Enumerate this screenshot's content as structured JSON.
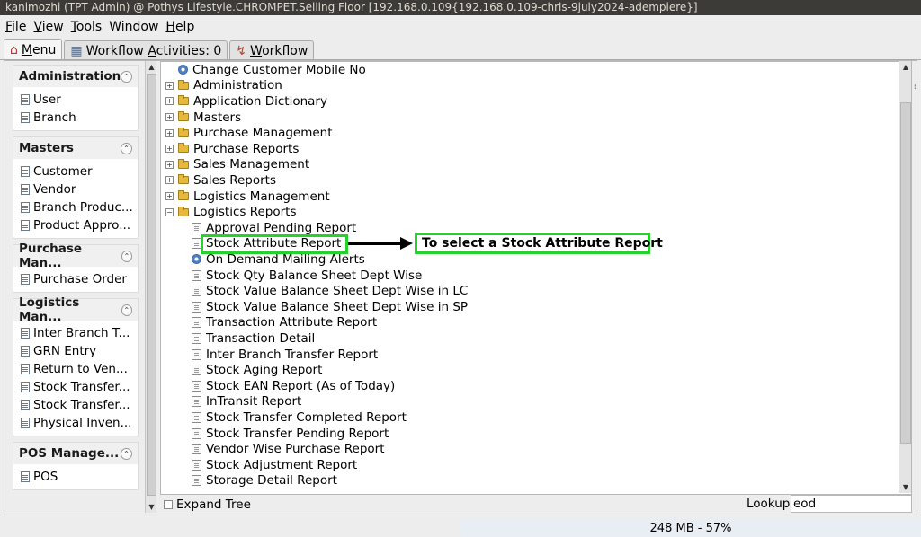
{
  "window": {
    "title": "kanimozhi (TPT Admin) @ Pothys Lifestyle.CHROMPET.Selling Floor [192.168.0.109{192.168.0.109-chrls-9july2024-adempiere}]"
  },
  "menu": [
    {
      "label": "File",
      "mnemonic": "F",
      "rest": "ile"
    },
    {
      "label": "View",
      "mnemonic": "V",
      "rest": "iew"
    },
    {
      "label": "Tools",
      "mnemonic": "T",
      "rest": "ools"
    },
    {
      "label": "Window",
      "mnemonic": "",
      "rest": "Window"
    },
    {
      "label": "Help",
      "mnemonic": "H",
      "rest": "elp"
    }
  ],
  "tabs": [
    {
      "label_pre": "",
      "label_mn": "M",
      "label_post": "enu",
      "icon": "home-icon"
    },
    {
      "label_pre": "Workflow ",
      "label_mn": "A",
      "label_post": "ctivities: 0",
      "icon": "calendar-icon"
    },
    {
      "label_pre": "",
      "label_mn": "W",
      "label_post": "orkflow",
      "icon": "workflow-icon"
    }
  ],
  "sidebar": {
    "groups": [
      {
        "title": "Administration",
        "items": [
          "User",
          "Branch"
        ]
      },
      {
        "title": "Masters",
        "items": [
          "Customer",
          "Vendor",
          "Branch Produc...",
          "Product Appro..."
        ]
      },
      {
        "title": "Purchase Man...",
        "items": [
          "Purchase Order"
        ]
      },
      {
        "title": "Logistics Man...",
        "items": [
          "Inter Branch T...",
          "GRN Entry",
          "Return to Ven...",
          "Stock Transfer...",
          "Stock Transfer...",
          "Physical Inven..."
        ]
      },
      {
        "title": "POS Manage...",
        "items": [
          "POS"
        ]
      }
    ]
  },
  "tree": {
    "items": [
      {
        "label": "Change Customer Mobile No",
        "kind": "process",
        "level": 1
      },
      {
        "label": "Administration",
        "kind": "folder",
        "level": 0,
        "expanded": false
      },
      {
        "label": "Application Dictionary",
        "kind": "folder",
        "level": 0,
        "expanded": false
      },
      {
        "label": "Masters",
        "kind": "folder",
        "level": 0,
        "expanded": false
      },
      {
        "label": "Purchase Management",
        "kind": "folder",
        "level": 0,
        "expanded": false
      },
      {
        "label": "Purchase Reports",
        "kind": "folder",
        "level": 0,
        "expanded": false
      },
      {
        "label": "Sales Management",
        "kind": "folder",
        "level": 0,
        "expanded": false
      },
      {
        "label": "Sales Reports",
        "kind": "folder",
        "level": 0,
        "expanded": false
      },
      {
        "label": "Logistics Management",
        "kind": "folder",
        "level": 0,
        "expanded": false
      },
      {
        "label": "Logistics Reports",
        "kind": "folder",
        "level": 0,
        "expanded": true
      },
      {
        "label": "Approval Pending Report",
        "kind": "report",
        "level": 2
      },
      {
        "label": "Stock Attribute Report",
        "kind": "report",
        "level": 2
      },
      {
        "label": "On Demand Mailing Alerts",
        "kind": "process",
        "level": 2
      },
      {
        "label": "Stock Qty Balance Sheet Dept Wise",
        "kind": "report",
        "level": 2
      },
      {
        "label": "Stock Value Balance Sheet Dept Wise in LC",
        "kind": "report",
        "level": 2
      },
      {
        "label": "Stock Value Balance Sheet Dept Wise in SP",
        "kind": "report",
        "level": 2
      },
      {
        "label": "Transaction Attribute Report",
        "kind": "report",
        "level": 2
      },
      {
        "label": "Transaction Detail",
        "kind": "report",
        "level": 2
      },
      {
        "label": "Inter Branch Transfer Report",
        "kind": "report",
        "level": 2
      },
      {
        "label": "Stock Aging Report",
        "kind": "report",
        "level": 2
      },
      {
        "label": "Stock EAN Report (As of Today)",
        "kind": "report",
        "level": 2
      },
      {
        "label": "InTransit Report",
        "kind": "report",
        "level": 2
      },
      {
        "label": "Stock Transfer Completed Report",
        "kind": "report",
        "level": 2
      },
      {
        "label": "Stock Transfer Pending Report",
        "kind": "report",
        "level": 2
      },
      {
        "label": "Vendor Wise Purchase Report",
        "kind": "report",
        "level": 2
      },
      {
        "label": "Stock Adjustment Report",
        "kind": "report",
        "level": 2
      },
      {
        "label": "Storage Detail Report",
        "kind": "report",
        "level": 2
      }
    ]
  },
  "annotation": {
    "text": "To select a Stock Attribute Report"
  },
  "bottom": {
    "expand_tree_label": "Expand Tree",
    "lookup_label": "Lookup",
    "lookup_value": "eod"
  },
  "status": {
    "memory": "248 MB - 57%"
  },
  "colors": {
    "highlight": "#27d12c",
    "folder": "#e7b83b",
    "title_bar": "#3c3b37"
  }
}
